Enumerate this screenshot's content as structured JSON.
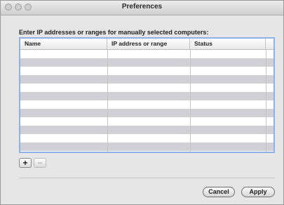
{
  "window": {
    "title": "Preferences"
  },
  "prompt": "Enter IP addresses or ranges for manually selected computers:",
  "table": {
    "columns": [
      "Name",
      "IP address or range",
      "Status",
      ""
    ],
    "rows": []
  },
  "buttons": {
    "add": "+",
    "remove": "−",
    "cancel": "Cancel",
    "apply": "Apply"
  },
  "colors": {
    "accent": "#8eb1e6"
  }
}
